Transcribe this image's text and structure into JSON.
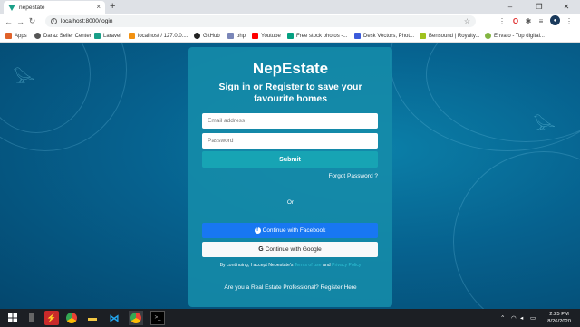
{
  "browser": {
    "tab_title": "nepestate",
    "tab_close": "×",
    "new_tab": "+",
    "url": "localhost:8000/login",
    "window_controls": {
      "minimize": "–",
      "maximize": "❐",
      "close": "✕"
    }
  },
  "bookmarks": [
    {
      "label": "Apps",
      "color": "#e0622a"
    },
    {
      "label": "Daraz Seller Center",
      "color": "#555555"
    },
    {
      "label": "Laravel",
      "color": "#1a9f88"
    },
    {
      "label": "localhost / 127.0.0....",
      "color": "#f29111"
    },
    {
      "label": "GitHub",
      "color": "#222222"
    },
    {
      "label": "php",
      "color": "#7a86b8"
    },
    {
      "label": "Youtube",
      "color": "#ff0000"
    },
    {
      "label": "Free stock photos -...",
      "color": "#05a081"
    },
    {
      "label": "Desk Vectors, Phot...",
      "color": "#3b5bdb"
    },
    {
      "label": "Bensound | Royalty...",
      "color": "#a0c21e"
    },
    {
      "label": "Envato - Top digital...",
      "color": "#82b541"
    }
  ],
  "login": {
    "brand": "NepEstate",
    "subtitle": "Sign in or Register to save your favourite homes",
    "email_placeholder": "Email address",
    "password_placeholder": "Password",
    "submit_label": "Submit",
    "forgot_label": "Forgot Password ?",
    "or_label": "Or",
    "facebook_label": "Continue with Facebook",
    "google_label": "Continue with Google",
    "terms_prefix": "By continuing, I accept Nepestate's",
    "terms_link": "Terms of use",
    "terms_and": "and",
    "privacy_link": "Privacy Policy",
    "realestate_label": "Are you a Real Estate Professional? Register Here"
  },
  "taskbar": {
    "time": "2:25 PM",
    "date": "8/26/2020"
  },
  "colors": {
    "accent": "#17a4b4",
    "facebook": "#1877f2",
    "card": "#168caa"
  }
}
